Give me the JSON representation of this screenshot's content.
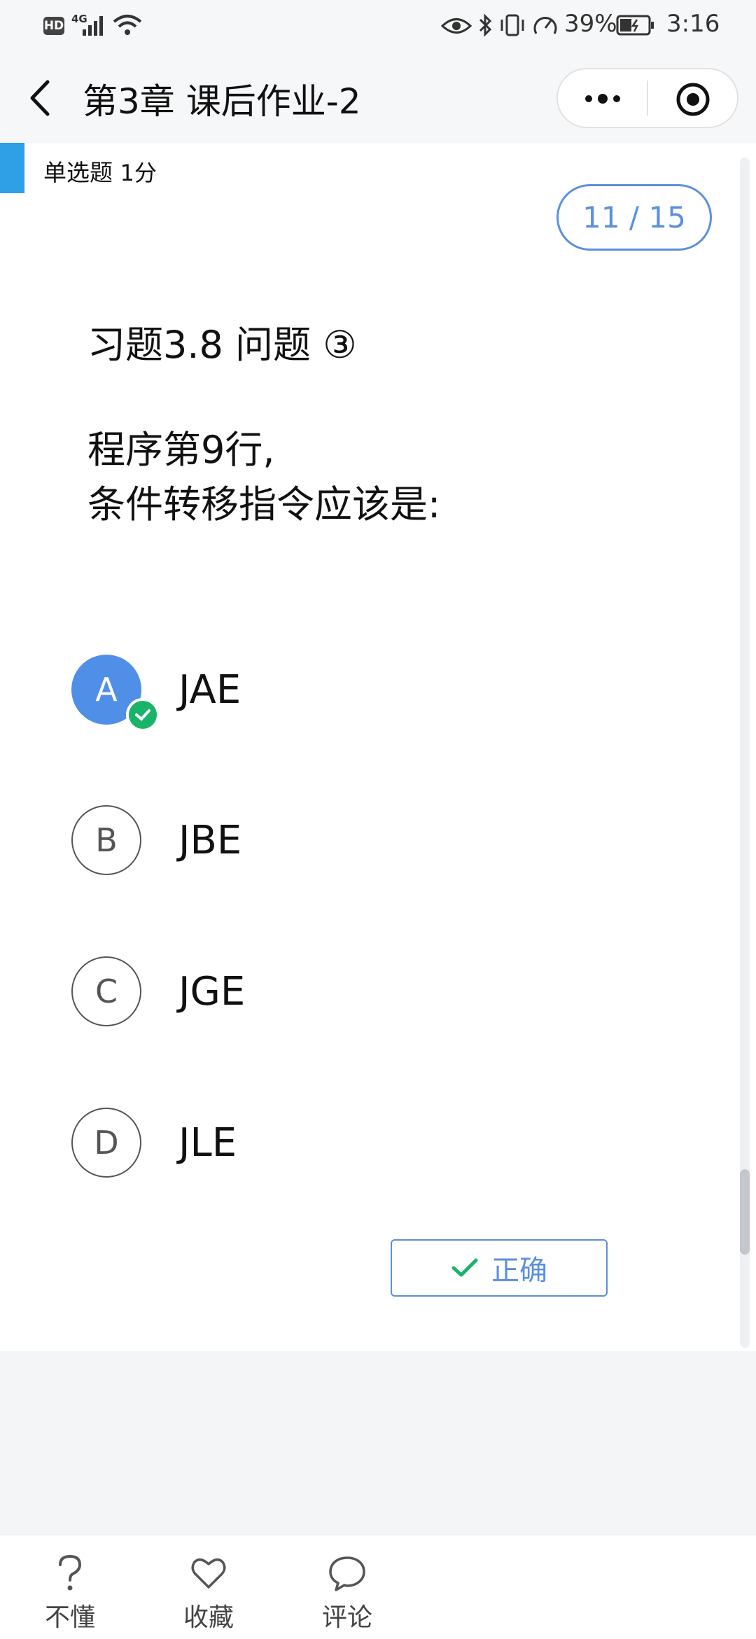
{
  "status_bar": {
    "hd_badge": "HD",
    "network": "4G",
    "battery": "39%",
    "time": "3:16"
  },
  "nav": {
    "title": "第3章 课后作业-2",
    "icons": [
      "back-arrow-icon",
      "more-icon",
      "record-icon"
    ]
  },
  "question": {
    "type_label": "单选题",
    "score": "1分",
    "progress": "11 / 15",
    "title": "习题3.8  问题 ③",
    "body_lines": [
      "程序第9行,",
      "条件转移指令应该是:"
    ]
  },
  "options": [
    {
      "letter": "A",
      "text": "JAE",
      "selected": true
    },
    {
      "letter": "B",
      "text": "JBE",
      "selected": false
    },
    {
      "letter": "C",
      "text": "JGE",
      "selected": false
    },
    {
      "letter": "D",
      "text": "JLE",
      "selected": false
    }
  ],
  "result": {
    "label": "正确",
    "icon": "check-icon"
  },
  "toolbar": {
    "items": [
      {
        "label": "不懂",
        "icon": "question-icon"
      },
      {
        "label": "收藏",
        "icon": "heart-icon"
      },
      {
        "label": "评论",
        "icon": "comment-icon"
      }
    ]
  },
  "colors": {
    "accent_blue": "#4f8fe8",
    "outline_blue": "#5b8fe0",
    "success_green": "#19b46a",
    "type_bar_blue": "#2f9fe6"
  }
}
